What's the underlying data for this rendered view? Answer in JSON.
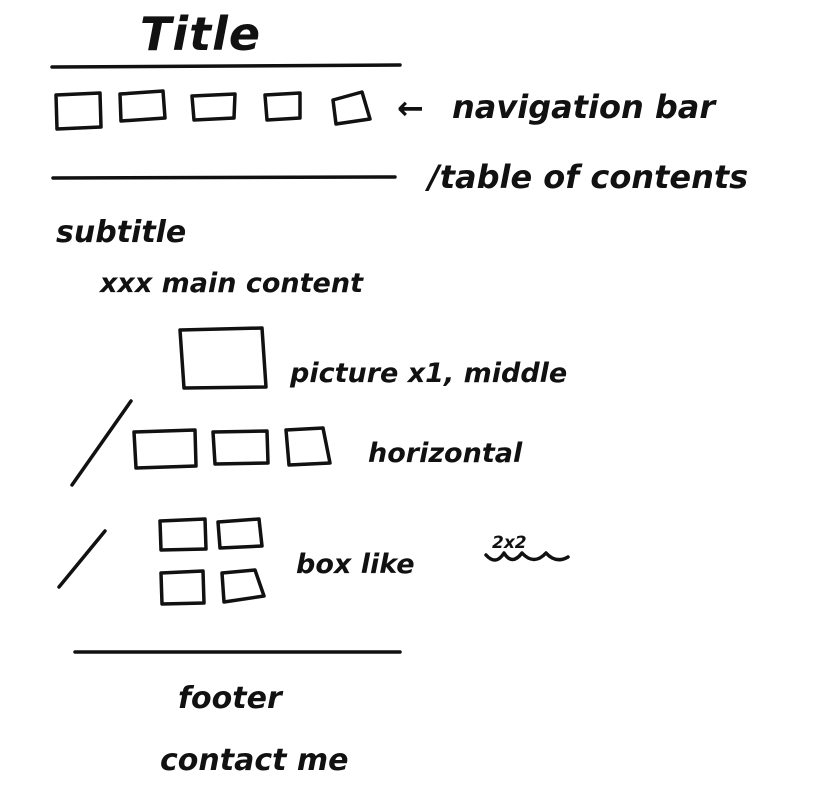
{
  "title": "Title",
  "navigation": {
    "box_count": 5,
    "arrow_glyph": "←",
    "label": "navigation bar",
    "alt_label": "/table of contents"
  },
  "content": {
    "subtitle": "subtitle",
    "main_text": "xxx main content",
    "picture_label": "picture x1, middle",
    "horizontal_label": "horizontal",
    "box_label": "box like",
    "box_note": "2x2"
  },
  "footer": {
    "label": "footer",
    "contact": "contact me"
  }
}
